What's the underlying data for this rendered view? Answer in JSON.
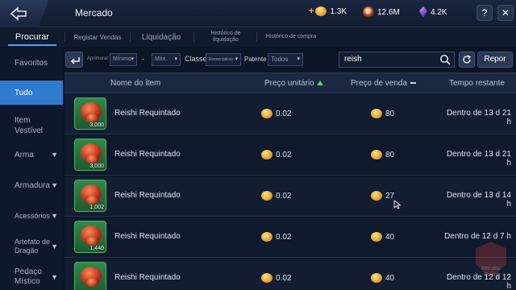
{
  "header": {
    "title": "Mercado",
    "currencies": [
      {
        "icon": "gold-coin-icon",
        "value": "1.3K",
        "has_plus": true
      },
      {
        "icon": "ruby-coin-icon",
        "value": "12.6M",
        "has_plus": false
      },
      {
        "icon": "purple-gem-icon",
        "value": "4.2K",
        "has_plus": false
      }
    ],
    "plus": "+",
    "help": "?",
    "close": "✕"
  },
  "tabs": [
    {
      "label": "Procurar",
      "active": true
    },
    {
      "label": "Registar Vendas",
      "active": false
    },
    {
      "label": "Liquidação",
      "active": false
    },
    {
      "label": "Histórico de liquidação",
      "active": false
    },
    {
      "label": "Histórico de compra",
      "active": false
    }
  ],
  "sidebar": {
    "items": [
      {
        "label": "Favoritos",
        "has_chevron": false,
        "active": false
      },
      {
        "label": "Tudo",
        "has_chevron": false,
        "active": true
      },
      {
        "label": "Item Vestível",
        "has_chevron": false,
        "active": false
      },
      {
        "label": "Arma",
        "has_chevron": true,
        "active": false
      },
      {
        "label": "Armadura",
        "has_chevron": true,
        "active": false
      },
      {
        "label": "Acessórios",
        "has_chevron": true,
        "active": false
      },
      {
        "label": "Artefato de Dragão",
        "has_chevron": true,
        "active": false
      },
      {
        "label": "Pedaço Místico",
        "has_chevron": true,
        "active": false
      }
    ]
  },
  "filters": {
    "improve_label": "Aprimorar",
    "min_value": "Mínimo",
    "dash": "-",
    "max_value": "Máx.",
    "class_label": "Classe",
    "class_value": "Elementalista",
    "patent_label": "Patente",
    "patent_value": "Todos",
    "search_value": "reish",
    "reset_label": "Repor",
    "dropdown_glyph": "▾"
  },
  "table": {
    "headers": {
      "name": "Nome do item",
      "unit_price": "Preço unitário",
      "sale_price": "Preço de venda",
      "time_left": "Tempo restante"
    },
    "rows": [
      {
        "name": "Reishi Requintado",
        "qty": "3,000",
        "unit_price": "0.02",
        "sale_price": "80",
        "time_left": "Dentro de 13 d 21 h"
      },
      {
        "name": "Reishi Requintado",
        "qty": "3,000",
        "unit_price": "0.02",
        "sale_price": "80",
        "time_left": "Dentro de 13 d 21 h"
      },
      {
        "name": "Reishi Requintado",
        "qty": "1,002",
        "unit_price": "0.02",
        "sale_price": "27",
        "time_left": "Dentro de 13 d 14 h"
      },
      {
        "name": "Reishi Requintado",
        "qty": "1,440",
        "unit_price": "0.02",
        "sale_price": "40",
        "time_left": "Dentro de 12 d 7 h"
      },
      {
        "name": "Reishi Requintado",
        "qty": "",
        "unit_price": "0.02",
        "sale_price": "40",
        "time_left": "Dentro de 12 d 12 h"
      }
    ]
  },
  "watermark": {
    "line1": "Rei dos",
    "line2": "Coins"
  }
}
